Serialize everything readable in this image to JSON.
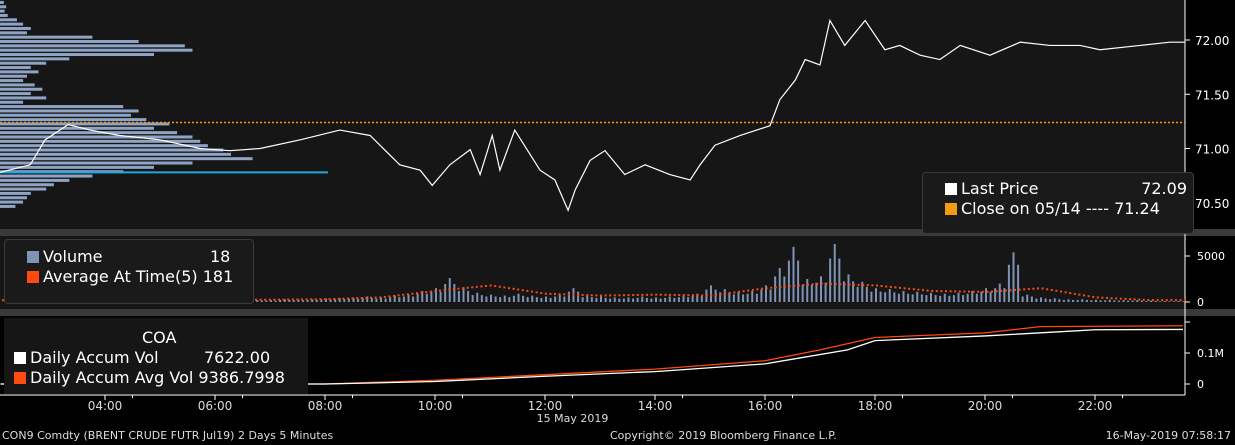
{
  "colors": {
    "price": "#ffffff",
    "close": "#f39c12",
    "profile": "#8fa3c4",
    "profile_hi": "#1fa8e0",
    "volume": "#7f93b5",
    "avg": "#ff4a10",
    "accum": "#ffffff",
    "accum_avg": "#ff4a10"
  },
  "price_legend": {
    "last_label": "Last Price",
    "last_value": "72.09",
    "close_label": "Close on 05/14 ---- 71.24"
  },
  "volume_legend": {
    "vol_label": "Volume",
    "vol_value": "18",
    "avg_label": "Average At Time(5)",
    "avg_value": "181"
  },
  "accum_legend": {
    "title": "COA",
    "vol_label": "Daily Accum Vol",
    "vol_value": "7622.00",
    "avg_label": "Daily Accum Avg Vol",
    "avg_value": "9386.7998"
  },
  "footer": {
    "left": "CON9 Comdty (BRENT CRUDE FUTR  Jul19) 2 Days 5 Minutes",
    "center": "Copyright© 2019 Bloomberg Finance L.P.",
    "right": "16-May-2019 07:58:17"
  },
  "chart_data": [
    {
      "type": "line",
      "title": "Last Price",
      "y_ticks": [
        "72.00",
        "71.50",
        "71.00",
        "70.50"
      ],
      "ylim": [
        70.36,
        72.36
      ],
      "close_line": 71.24,
      "highlight_level": 70.78,
      "x": [
        2.09,
        2.64,
        2.91,
        3.33,
        3.73,
        4.27,
        5.0,
        5.73,
        6.27,
        6.82,
        7.55,
        8.27,
        8.82,
        9.36,
        9.73,
        9.95,
        10.27,
        10.64,
        10.82,
        11.04,
        11.18,
        11.45,
        11.91,
        12.18,
        12.42,
        12.55,
        12.82,
        13.09,
        13.45,
        13.82,
        14.27,
        14.64,
        14.82,
        15.09,
        15.55,
        16.09,
        16.27,
        16.55,
        16.73,
        17.0,
        17.18,
        17.45,
        17.82,
        18.18,
        18.45,
        18.82,
        19.18,
        19.55,
        20.09,
        20.64,
        21.18,
        21.73,
        22.09,
        22.82,
        23.36,
        23.64
      ],
      "y": [
        70.78,
        70.85,
        71.08,
        71.22,
        71.17,
        71.12,
        71.08,
        71.0,
        70.98,
        71.0,
        71.08,
        71.17,
        71.12,
        70.85,
        70.8,
        70.66,
        70.85,
        70.99,
        70.76,
        71.12,
        70.8,
        71.17,
        70.8,
        70.71,
        70.43,
        70.62,
        70.89,
        70.98,
        70.76,
        70.85,
        70.76,
        70.71,
        70.85,
        71.03,
        71.12,
        71.21,
        71.45,
        71.63,
        71.82,
        71.77,
        72.18,
        71.95,
        72.18,
        71.91,
        71.95,
        71.86,
        71.82,
        71.95,
        71.86,
        71.98,
        71.95,
        71.95,
        71.91,
        71.95,
        71.98,
        71.98
      ],
      "profile_top": 72.36,
      "profile_step": 0.04,
      "profile": [
        5,
        8,
        6,
        10,
        22,
        30,
        40,
        35,
        120,
        180,
        240,
        250,
        200,
        90,
        60,
        40,
        50,
        35,
        30,
        45,
        55,
        40,
        60,
        30,
        160,
        180,
        170,
        190,
        220,
        200,
        230,
        250,
        260,
        270,
        290,
        300,
        328,
        250,
        200,
        160,
        120,
        90,
        70,
        60,
        40,
        35,
        30,
        20
      ]
    },
    {
      "type": "bar",
      "title": "Volume",
      "y_ticks": [
        "5000",
        "0"
      ],
      "ylim": [
        0,
        5000
      ],
      "x_start": 2.25,
      "x_step": 0.25,
      "values": [
        100,
        150,
        120,
        200,
        150,
        180,
        200,
        150,
        250,
        180,
        200,
        220,
        150,
        250,
        200,
        180,
        200,
        250,
        220,
        200,
        300,
        250,
        280,
        350,
        400,
        450,
        600,
        500,
        700,
        800,
        1200,
        1500,
        2600,
        1600,
        1000,
        800,
        700,
        900,
        700,
        600,
        800,
        1500,
        700,
        600,
        500,
        500,
        600,
        500,
        600,
        700,
        900,
        1800,
        1400,
        1100,
        1200,
        1800,
        3700,
        6000,
        2500,
        2800,
        6300,
        3000,
        2200,
        1500,
        1400,
        1200,
        1100,
        1000,
        900,
        1000,
        1200,
        1500,
        2000,
        5400,
        800,
        500,
        400,
        300,
        300,
        250,
        250,
        200,
        200,
        150,
        100,
        100
      ],
      "avg_x_start": 2,
      "avg_x_step": 1,
      "avg": [
        200,
        200,
        200,
        250,
        250,
        250,
        300,
        500,
        1200,
        1800,
        900,
        700,
        800,
        700,
        1500,
        2000,
        1800,
        1200,
        1100,
        1500,
        500,
        200
      ]
    },
    {
      "type": "line",
      "title": "COA",
      "y_ticks": [
        "0.1M",
        "0"
      ],
      "ylim": [
        0,
        100000
      ],
      "series": [
        {
          "name": "Daily Accum Vol",
          "x": [
            2.1,
            8,
            10,
            12,
            14,
            16,
            16.5,
            17.5,
            18,
            20,
            21.5,
            22,
            23.6
          ],
          "y": [
            0,
            0,
            8000,
            25000,
            40000,
            65000,
            80000,
            110000,
            140000,
            155000,
            170000,
            175000,
            176000
          ]
        },
        {
          "name": "Daily Accum Avg Vol",
          "x": [
            2.1,
            8,
            10,
            12,
            14,
            16,
            17,
            18,
            20,
            21,
            23.6
          ],
          "y": [
            0,
            0,
            12000,
            30000,
            48000,
            75000,
            110000,
            150000,
            165000,
            185000,
            188000
          ]
        }
      ]
    },
    {
      "x_ticks": [
        "04:00",
        "06:00",
        "08:00",
        "10:00",
        "12:00",
        "14:00",
        "16:00",
        "18:00",
        "20:00",
        "22:00"
      ],
      "x_tick_hours": [
        4,
        6,
        8,
        10,
        12,
        14,
        16,
        18,
        20,
        22
      ],
      "x_label": "15 May 2019"
    }
  ]
}
